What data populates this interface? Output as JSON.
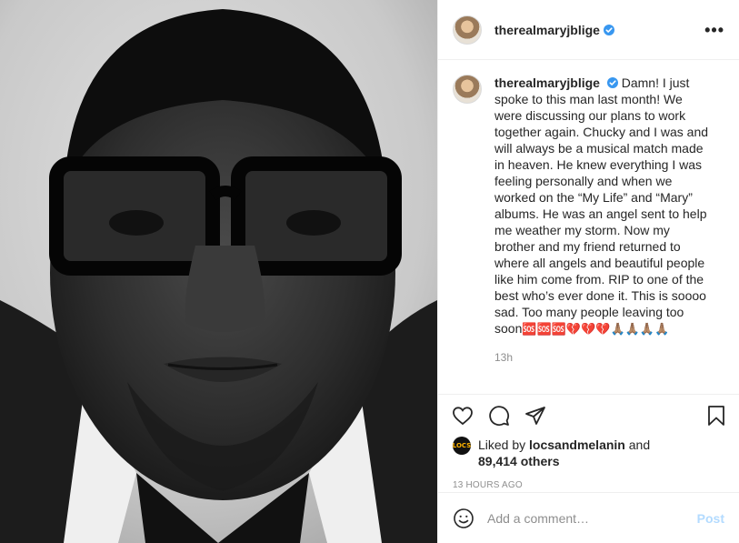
{
  "post": {
    "username": "therealmaryjblige",
    "verified": true,
    "more_icon": "more-options-icon",
    "caption": {
      "username": "therealmaryjblige",
      "text": "Damn! I just spoke to this man last month! We were discussing our plans to work together again. Chucky and I was and will always be a musical match made in heaven. He knew everything I was feeling personally and when we worked on the “My Life” and “Mary” albums. He was an angel sent to help me weather my storm. Now my brother and my friend returned to where all angels and beautiful people like him come from. RIP to one of the best who’s ever done it. This is soooo sad. Too many people leaving too soon",
      "emoji_boxes": "🆘🆘🆘",
      "emoji_hearts": "💔💔💔",
      "emoji_pray": "🙏🏽🙏🏽🙏🏽🙏🏽",
      "time": "13h"
    },
    "likes": {
      "prefix": "Liked by",
      "user": "locsandmelanin",
      "conjunction": "and",
      "others": "89,414 others",
      "avatar_text": "LOCS"
    },
    "timestamp": "13 HOURS AGO",
    "comment": {
      "placeholder": "Add a comment…",
      "post_label": "Post"
    }
  },
  "colors": {
    "verified_blue": "#3897f0",
    "post_button": "#b3dbff",
    "secondary_text": "#8e8e8e"
  }
}
